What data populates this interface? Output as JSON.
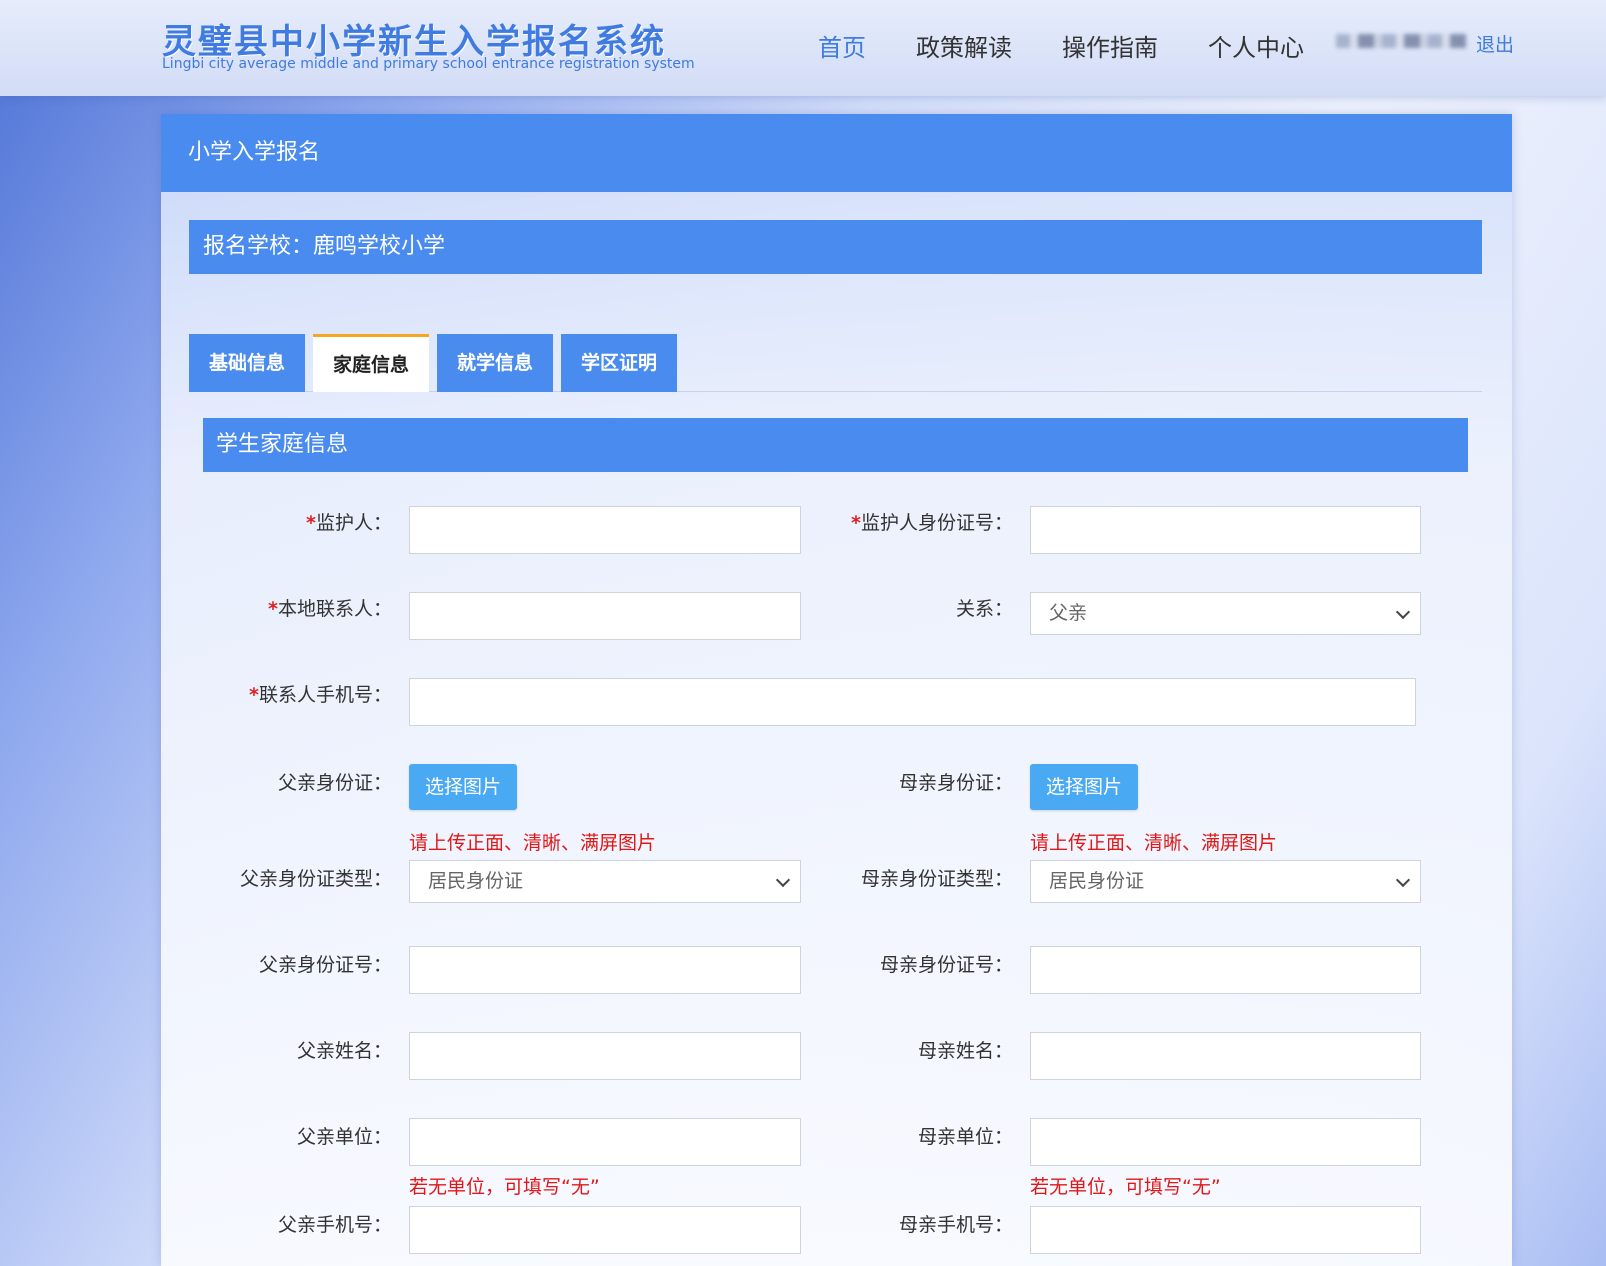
{
  "header": {
    "logo_title": "灵璧县中小学新生入学报名系统",
    "logo_subtitle": "Lingbi city average middle and primary school entrance registration system",
    "nav": [
      "首页",
      "政策解读",
      "操作指南",
      "个人中心"
    ],
    "logout": "退出"
  },
  "card": {
    "title": "小学入学报名",
    "school": "报名学校：鹿鸣学校小学",
    "tabs": [
      "基础信息",
      "家庭信息",
      "就学信息",
      "学区证明"
    ],
    "active_tab": "家庭信息",
    "section_title": "学生家庭信息"
  },
  "form": {
    "guardian_label": "监护人：",
    "guardian_id_label": "监护人身份证号：",
    "local_contact_label": "本地联系人：",
    "relation_label": "关系：",
    "relation_value": "父亲",
    "contact_phone_label": "联系人手机号：",
    "required_mark": "*",
    "father_id_card_label": "父亲身份证：",
    "mother_id_card_label": "母亲身份证：",
    "choose_image": "选择图片",
    "upload_hint": "请上传正面、清晰、满屏图片",
    "father_id_type_label": "父亲身份证类型：",
    "mother_id_type_label": "母亲身份证类型：",
    "id_type_value": "居民身份证",
    "father_id_no_label": "父亲身份证号：",
    "mother_id_no_label": "母亲身份证号：",
    "father_name_label": "父亲姓名：",
    "mother_name_label": "母亲姓名：",
    "father_work_label": "父亲单位：",
    "mother_work_label": "母亲单位：",
    "work_hint": "若无单位，可填写“无”",
    "father_phone_label": "父亲手机号：",
    "mother_phone_label": "母亲手机号："
  },
  "colors": {
    "primary": "#4a8bf0",
    "button": "#4aa9f3",
    "tab_accent": "#f5a623",
    "hint_red": "#e01818"
  }
}
